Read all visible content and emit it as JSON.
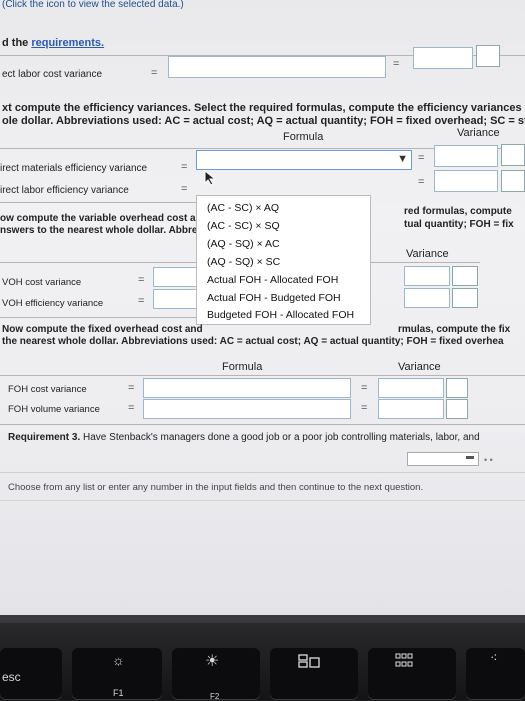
{
  "top": {
    "click_icon": "(Click the icon to view the selected data.)",
    "read_prefix": "d the ",
    "requirements_link": "requirements.",
    "row1_label": "ect labor cost variance",
    "eq": "="
  },
  "eff": {
    "instr1": "xt compute the efficiency variances. Select the required formulas, compute the efficiency variances fo",
    "instr2": "ole dollar. Abbreviations used: AC = actual cost; AQ = actual quantity; FOH = fixed overhead; SC = sta",
    "formula_header": "Formula",
    "variance_header": "Variance",
    "row1_label": "irect materials efficiency variance",
    "row2_label": "irect labor efficiency variance"
  },
  "voh": {
    "instr1": "ow compute the variable overhead cost a",
    "instr2": "nswers to the nearest whole dollar. Abbre",
    "right1": "red formulas, compute",
    "right2": "tual quantity; FOH = fix",
    "variance_header": "Variance",
    "row1_label": "VOH cost variance",
    "row2_label": "VOH efficiency variance"
  },
  "dropdown": {
    "options": [
      "(AC - SC) × AQ",
      "(AC - SC) × SQ",
      "(AQ - SQ) × AC",
      "(AQ - SQ) × SC",
      "Actual FOH - Allocated FOH",
      "Actual FOH - Budgeted FOH",
      "Budgeted FOH - Allocated FOH"
    ],
    "arrow": "▼"
  },
  "foh": {
    "instr1_left": "Now compute the fixed overhead cost and",
    "instr1_right": "rmulas, compute the fix",
    "instr2": "the nearest whole dollar. Abbreviations used: AC = actual cost; AQ = actual quantity; FOH = fixed overhea",
    "formula_header": "Formula",
    "variance_header": "Variance",
    "row1_label": "FOH cost variance",
    "row2_label": "FOH volume variance"
  },
  "req3": {
    "bold": "Requirement 3.",
    "text": " Have Stenback's managers done a good job or a poor job controlling materials, labor, and"
  },
  "footer": {
    "choose": "Choose from any list or enter any number in the input fields and then continue to the next question."
  },
  "keyboard": {
    "esc": "esc",
    "f1": "F1",
    "f2": "F2"
  }
}
